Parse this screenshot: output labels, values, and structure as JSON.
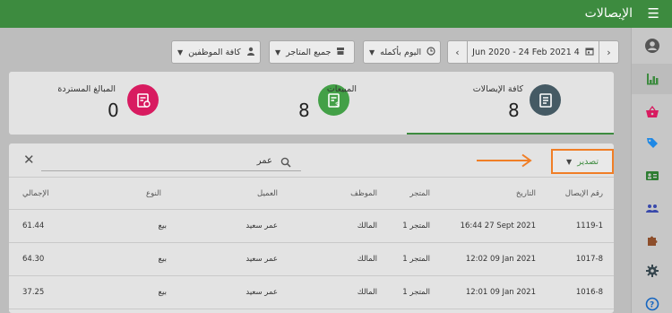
{
  "appbar": {
    "title": "الإيصالات",
    "menu_icon": "menu-icon"
  },
  "sidebar": {
    "items": [
      {
        "name": "account-icon",
        "color": "#555555"
      },
      {
        "name": "bar-chart-icon",
        "color": "#3d8b3f"
      },
      {
        "name": "shopping-basket-icon",
        "color": "#d81b60"
      },
      {
        "name": "sale-tag-icon",
        "color": "#1e88e5"
      },
      {
        "name": "employee-card-icon",
        "color": "#2e7d32"
      },
      {
        "name": "users-icon",
        "color": "#3949ab"
      },
      {
        "name": "puzzle-icon",
        "color": "#8d4e2b"
      },
      {
        "name": "settings-icon",
        "color": "#37474f"
      },
      {
        "name": "help-icon",
        "color": "#1565c0"
      }
    ]
  },
  "toolbar": {
    "date_range": "Jun 2020 - 24 Feb 2021 4",
    "prev": "‹",
    "next": "›",
    "time": "اليوم بأكمله",
    "stores": "جميع المتاجر",
    "employees": "كافة الموظفين"
  },
  "summary": {
    "receipts": {
      "label": "كافة الإيصالات",
      "value": "8",
      "color": "#455a64"
    },
    "sales": {
      "label": "المبيعات",
      "value": "8",
      "color": "#43a047"
    },
    "refunds": {
      "label": "المبالغ المستردة",
      "value": "0",
      "color": "#d81b60"
    }
  },
  "table": {
    "export_label": "تصدير",
    "search_value": "عمر",
    "headers": [
      "رقم الإيصال",
      "التاريخ",
      "المتجر",
      "الموظف",
      "العميل",
      "النوع",
      "الإجمالي"
    ],
    "rows": [
      [
        "1119-1",
        "16:44 27 Sept 2021",
        "المتجر 1",
        "المالك",
        "عمر سعيد",
        "بيع",
        "61.44"
      ],
      [
        "1017-8",
        "12:02 09 Jan 2021",
        "المتجر 1",
        "المالك",
        "عمر سعيد",
        "بيع",
        "64.30"
      ],
      [
        "1016-8",
        "12:01 09 Jan 2021",
        "المتجر 1",
        "المالك",
        "عمر سعيد",
        "بيع",
        "37.25"
      ]
    ]
  },
  "colors": {
    "brand": "#3d8b3f",
    "highlight": "#f07e26"
  }
}
